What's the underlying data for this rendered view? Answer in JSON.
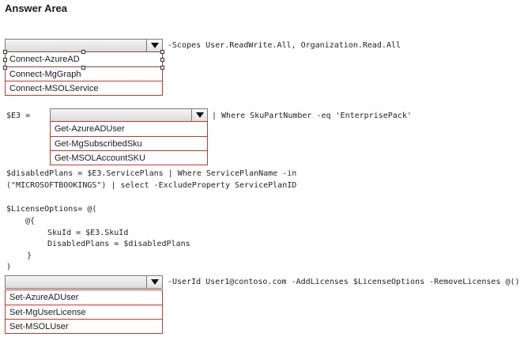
{
  "title": "Answer Area",
  "dropdown1": {
    "suffix": "-Scopes User.ReadWrite.All, Organization.Read.All",
    "options": [
      "Connect-AzureAD",
      "Connect-MgGraph",
      "Connect-MSOLService"
    ]
  },
  "dropdown2": {
    "prefix": "$E3 =",
    "suffix": "| Where SkuPartNumber -eq 'EnterprisePack'",
    "options": [
      "Get-AzureADUser",
      "Get-MgSubscribedSku",
      "Get-MSOLAccountSKU"
    ]
  },
  "code": {
    "disabled_line1": "$disabledPlans = $E3.ServicePlans | Where ServicePlanName -in",
    "disabled_line2": "(\"MICROSOFTBOOKINGS\") | select -ExcludeProperty ServicePlanID",
    "license_line1": "$LicenseOptions= @(",
    "license_line2": "@{",
    "license_line3": "SkuId = $E3.SkuId",
    "license_line4": "DisabledPlans = $disabledPlans",
    "license_line5": "}",
    "license_line6": ")"
  },
  "dropdown3": {
    "suffix": "-UserId User1@contoso.com -AddLicenses $LicenseOptions -RemoveLicenses @()",
    "options": [
      "Set-AzureADUser",
      "Set-MgUserLicense",
      "Set-MSOLUser"
    ]
  },
  "icons": {
    "dropdown_arrow": "triangle-down-icon"
  }
}
